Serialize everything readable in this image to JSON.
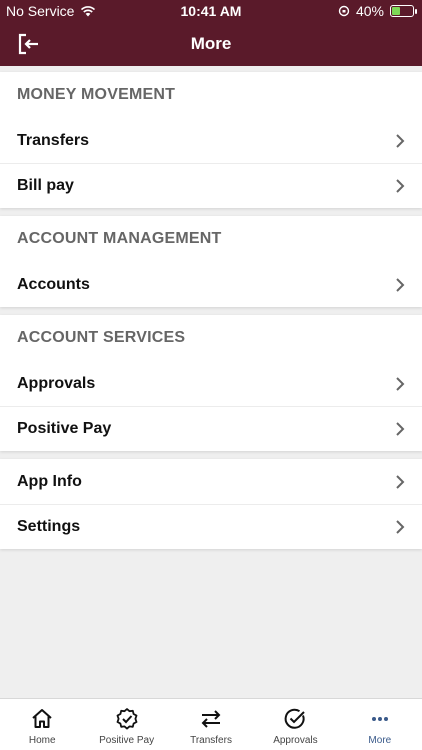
{
  "status": {
    "carrier": "No Service",
    "time": "10:41 AM",
    "battery": "40%",
    "battery_level": 0.4
  },
  "header": {
    "title": "More"
  },
  "sections": [
    {
      "title": "MONEY MOVEMENT",
      "items": [
        "Transfers",
        "Bill pay"
      ]
    },
    {
      "title": "ACCOUNT MANAGEMENT",
      "items": [
        "Accounts"
      ]
    },
    {
      "title": "ACCOUNT SERVICES",
      "items": [
        "Approvals",
        "Positive Pay"
      ]
    },
    {
      "title": "",
      "items": [
        "App Info",
        "Settings"
      ]
    }
  ],
  "tabs": [
    {
      "label": "Home",
      "icon": "home-icon"
    },
    {
      "label": "Positive Pay",
      "icon": "badge-check-icon"
    },
    {
      "label": "Transfers",
      "icon": "transfer-arrows-icon"
    },
    {
      "label": "Approvals",
      "icon": "check-circle-icon"
    },
    {
      "label": "More",
      "icon": "more-dots-icon",
      "active": true
    }
  ],
  "colors": {
    "brand": "#5a1a2a",
    "active_tab": "#3a5a8a"
  }
}
